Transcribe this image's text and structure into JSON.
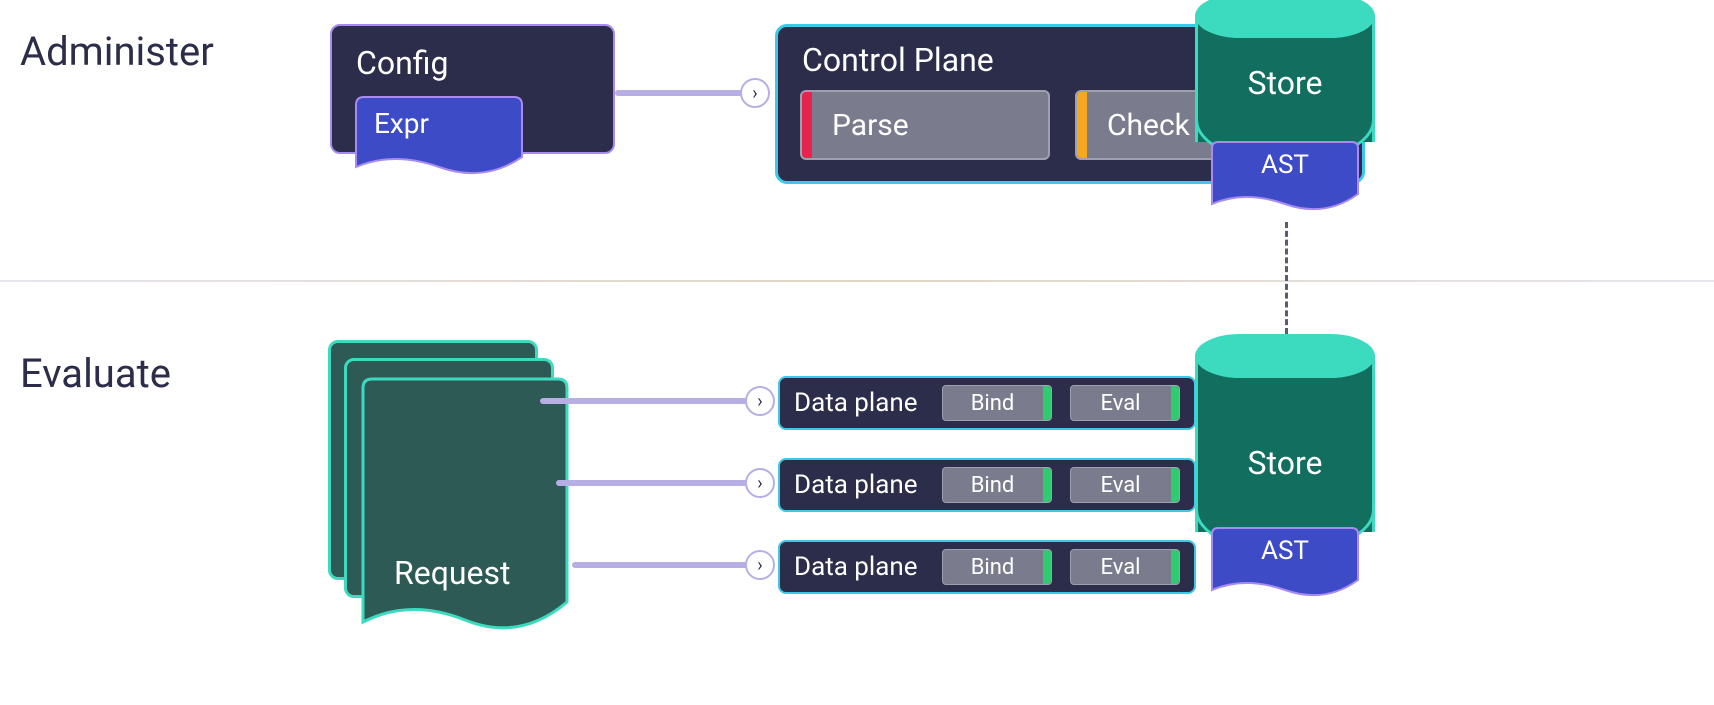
{
  "sections": {
    "administer": "Administer",
    "evaluate": "Evaluate"
  },
  "config": {
    "title": "Config",
    "expr": "Expr"
  },
  "control_plane": {
    "title": "Control Plane",
    "steps": [
      {
        "label": "Parse",
        "accent": "#e6254f"
      },
      {
        "label": "Check",
        "accent": "#f5a623"
      }
    ]
  },
  "store": {
    "label": "Store",
    "ast": "AST"
  },
  "data_planes": [
    {
      "title": "Data plane",
      "steps": [
        "Bind",
        "Eval"
      ]
    },
    {
      "title": "Data plane",
      "steps": [
        "Bind",
        "Eval"
      ]
    },
    {
      "title": "Data plane",
      "steps": [
        "Bind",
        "Eval"
      ]
    }
  ],
  "request": {
    "label": "Request"
  },
  "colors": {
    "dark": "#2b2d4a",
    "purple_border": "#a88bf0",
    "teal_border": "#3cdbc0",
    "cyan_border": "#3cc8e6",
    "indigo": "#3d4bc7",
    "green_accent": "#2ecc71"
  }
}
